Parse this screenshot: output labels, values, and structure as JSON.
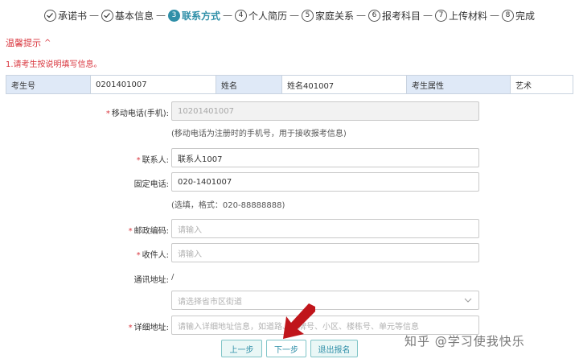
{
  "steps": [
    {
      "label": "承诺书",
      "marker": "✓"
    },
    {
      "label": "基本信息",
      "marker": "✓"
    },
    {
      "label": "联系方式",
      "marker": "3"
    },
    {
      "label": "个人简历",
      "marker": "4"
    },
    {
      "label": "家庭关系",
      "marker": "5"
    },
    {
      "label": "报考科目",
      "marker": "6"
    },
    {
      "label": "上传材料",
      "marker": "7"
    },
    {
      "label": "完成",
      "marker": "8"
    }
  ],
  "step_separator": "—",
  "tip": {
    "title": "温馨提示",
    "caret": "^",
    "line": "1.请考生按说明填写信息。"
  },
  "info": {
    "exam_no_label": "考生号",
    "exam_no_value": "0201401007",
    "name_label": "姓名",
    "name_value": "姓名401007",
    "attr_label": "考生属性",
    "attr_value": "艺术"
  },
  "form": {
    "mobile": {
      "label": "移动电话(手机):",
      "value": "10201401007",
      "hint": "(移动电话为注册时的手机号，用于接收报考信息)"
    },
    "contact": {
      "label": "联系人:",
      "value": "联系人1007"
    },
    "phone": {
      "label": "固定电话:",
      "value": "020-1401007",
      "hint": "(选填，格式：020-88888888)"
    },
    "postcode": {
      "label": "邮政编码:",
      "placeholder": "请输入"
    },
    "recipient": {
      "label": "收件人:",
      "placeholder": "请输入"
    },
    "address_label": "通讯地址:",
    "address_slash": "/",
    "region": {
      "placeholder": "请选择省市区街道"
    },
    "detail": {
      "label": "详细地址:",
      "placeholder": "请输入详细地址信息，如道路、门牌号、小区、楼栋号、单元等信息"
    }
  },
  "required_mark": "*",
  "buttons": {
    "prev": "上一步",
    "next": "下一步",
    "exit": "退出报名"
  },
  "watermark": "知乎 @学习使我快乐",
  "colors": {
    "accent": "#2f8fa8",
    "warning": "#d9363e",
    "arrow": "#c0151b",
    "header_cell": "#dfe9f7"
  }
}
